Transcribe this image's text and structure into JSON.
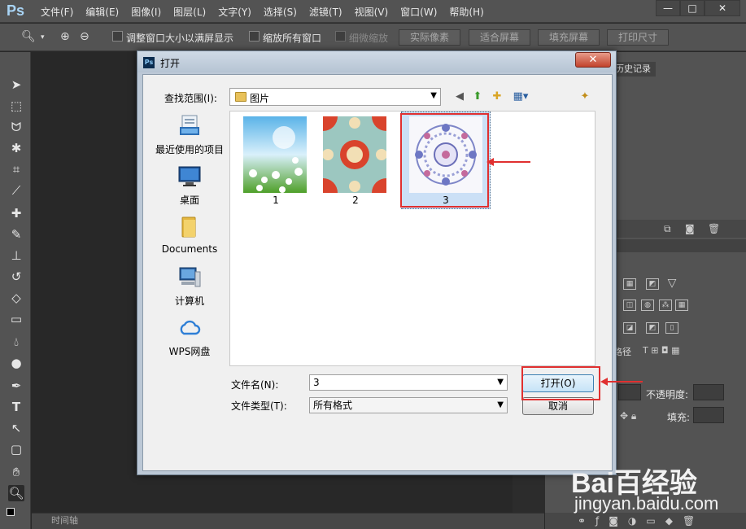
{
  "app": {
    "logo": "Ps"
  },
  "menu": [
    "文件(F)",
    "编辑(E)",
    "图像(I)",
    "图层(L)",
    "文字(Y)",
    "选择(S)",
    "滤镜(T)",
    "视图(V)",
    "窗口(W)",
    "帮助(H)"
  ],
  "window_controls": {
    "minimize": "—",
    "maximize": "□",
    "close": "✕"
  },
  "options": {
    "resize_windows": "调整窗口大小以满屏显示",
    "zoom_all": "缩放所有窗口",
    "scrubby_zoom": "细微缩放",
    "actual_pixels": "实际像素",
    "fit_screen": "适合屏幕",
    "fill_screen": "填充屏幕",
    "print_size": "打印尺寸"
  },
  "timeline": "时间轴",
  "right": {
    "history_tab": "历史记录",
    "paths_tab": "路径",
    "opacity_label": "不透明度:",
    "fill_label": "填充:"
  },
  "dialog": {
    "title": "打开",
    "close": "✕",
    "look_in_label": "查找范围(I):",
    "look_in_value": "图片",
    "places": [
      {
        "label": "最近使用的项目",
        "icon": "recent-icon"
      },
      {
        "label": "桌面",
        "icon": "desktop-icon"
      },
      {
        "label": "Documents",
        "icon": "folder-icon"
      },
      {
        "label": "计算机",
        "icon": "computer-icon"
      },
      {
        "label": "WPS网盘",
        "icon": "cloud-icon"
      }
    ],
    "files": [
      {
        "label": "1"
      },
      {
        "label": "2"
      },
      {
        "label": "3"
      }
    ],
    "filename_label": "文件名(N):",
    "filename_value": "3",
    "filetype_label": "文件类型(T):",
    "filetype_value": "所有格式",
    "open_button": "打开(O)",
    "cancel_button": "取消"
  },
  "watermark": {
    "line1": "Bai百经验",
    "line2": "jingyan.baidu.com"
  },
  "colors": {
    "annotation": "#e03030",
    "ps_blue": "#a9d4f5"
  }
}
